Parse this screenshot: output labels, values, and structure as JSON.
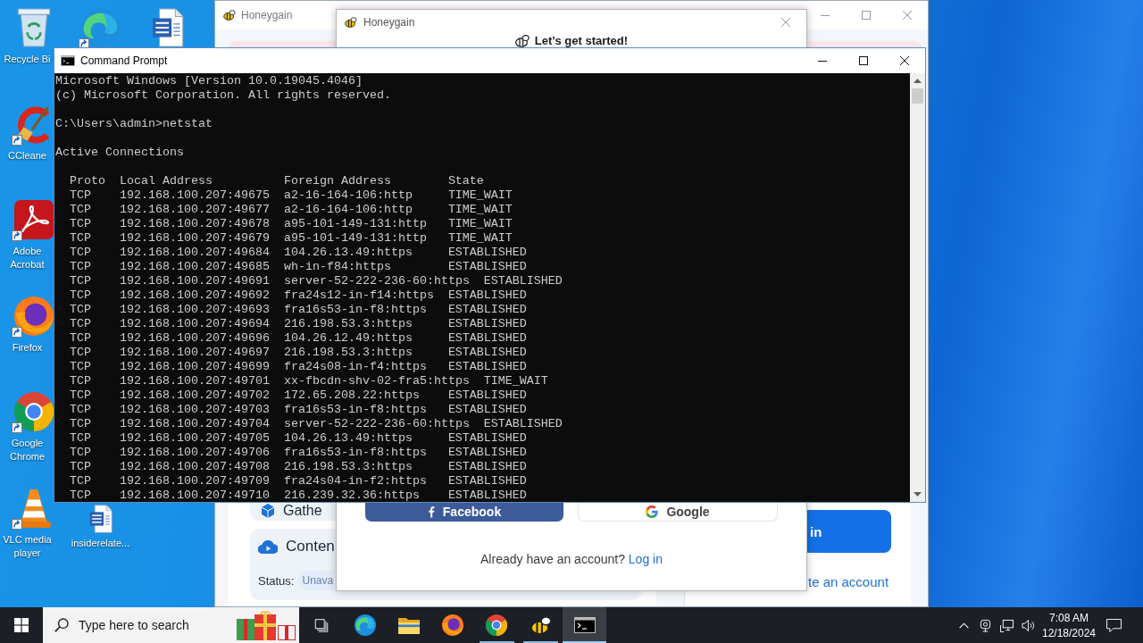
{
  "desktop": {
    "icons": [
      {
        "kind": "recycle-bin",
        "label": "Recycle Bi",
        "shortcut": false
      },
      {
        "kind": "edge",
        "shortcut": true
      },
      {
        "kind": "word",
        "shortcut": false
      },
      {
        "kind": "ccleaner",
        "label": "CCleane",
        "shortcut": true
      },
      {
        "kind": "acrobat",
        "label": "Adobe Acrobat",
        "shortcut": true
      },
      {
        "kind": "firefox",
        "label": "Firefox",
        "shortcut": true
      },
      {
        "kind": "chrome",
        "label": "Google Chrome",
        "shortcut": true
      },
      {
        "kind": "vlc",
        "label": "VLC media player",
        "shortcut": true
      },
      {
        "kind": "word",
        "label": "insiderelate...",
        "shortcut": false
      }
    ]
  },
  "honeygain_window": {
    "title": "Honeygain",
    "cards": [
      {
        "kind": "gathering",
        "title": "Gathe"
      },
      {
        "kind": "content-delivery",
        "title": "Conten",
        "status_label": "Status:",
        "status": "Unava"
      }
    ],
    "side_panel": {
      "button": "in",
      "link": "te an account"
    }
  },
  "signup_dialog": {
    "title": "Honeygain",
    "heading": "Let’s get started!",
    "social_buttons": [
      {
        "kind": "facebook",
        "label": "Facebook"
      },
      {
        "kind": "google",
        "label": "Google"
      }
    ],
    "login_prompt": "Already have an account?",
    "login_link": "Log in"
  },
  "command_prompt": {
    "title": "Command Prompt",
    "banner": [
      "Microsoft Windows [Version 10.0.19045.4046]",
      "(c) Microsoft Corporation. All rights reserved."
    ],
    "prompt": "C:\\Users\\admin>netstat",
    "section": "Active Connections",
    "columns": [
      "Proto",
      "Local Address",
      "Foreign Address",
      "State"
    ],
    "rows": [
      {
        "proto": "TCP",
        "local_address": "192.168.100.207:49675",
        "foreign_address": "a2-16-164-106:http",
        "state": "TIME_WAIT"
      },
      {
        "proto": "TCP",
        "local_address": "192.168.100.207:49677",
        "foreign_address": "a2-16-164-106:http",
        "state": "TIME_WAIT"
      },
      {
        "proto": "TCP",
        "local_address": "192.168.100.207:49678",
        "foreign_address": "a95-101-149-131:http",
        "state": "TIME_WAIT"
      },
      {
        "proto": "TCP",
        "local_address": "192.168.100.207:49679",
        "foreign_address": "a95-101-149-131:http",
        "state": "TIME_WAIT"
      },
      {
        "proto": "TCP",
        "local_address": "192.168.100.207:49684",
        "foreign_address": "104.26.13.49:https",
        "state": "ESTABLISHED"
      },
      {
        "proto": "TCP",
        "local_address": "192.168.100.207:49685",
        "foreign_address": "wh-in-f84:https",
        "state": "ESTABLISHED"
      },
      {
        "proto": "TCP",
        "local_address": "192.168.100.207:49691",
        "foreign_address": "server-52-222-236-60:https",
        "state": "ESTABLISHED"
      },
      {
        "proto": "TCP",
        "local_address": "192.168.100.207:49692",
        "foreign_address": "fra24s12-in-f14:https",
        "state": "ESTABLISHED"
      },
      {
        "proto": "TCP",
        "local_address": "192.168.100.207:49693",
        "foreign_address": "fra16s53-in-f8:https",
        "state": "ESTABLISHED"
      },
      {
        "proto": "TCP",
        "local_address": "192.168.100.207:49694",
        "foreign_address": "216.198.53.3:https",
        "state": "ESTABLISHED"
      },
      {
        "proto": "TCP",
        "local_address": "192.168.100.207:49696",
        "foreign_address": "104.26.12.49:https",
        "state": "ESTABLISHED"
      },
      {
        "proto": "TCP",
        "local_address": "192.168.100.207:49697",
        "foreign_address": "216.198.53.3:https",
        "state": "ESTABLISHED"
      },
      {
        "proto": "TCP",
        "local_address": "192.168.100.207:49699",
        "foreign_address": "fra24s08-in-f4:https",
        "state": "ESTABLISHED"
      },
      {
        "proto": "TCP",
        "local_address": "192.168.100.207:49701",
        "foreign_address": "xx-fbcdn-shv-02-fra5:https",
        "state": "TIME_WAIT"
      },
      {
        "proto": "TCP",
        "local_address": "192.168.100.207:49702",
        "foreign_address": "172.65.208.22:https",
        "state": "ESTABLISHED"
      },
      {
        "proto": "TCP",
        "local_address": "192.168.100.207:49703",
        "foreign_address": "fra16s53-in-f8:https",
        "state": "ESTABLISHED"
      },
      {
        "proto": "TCP",
        "local_address": "192.168.100.207:49704",
        "foreign_address": "server-52-222-236-60:https",
        "state": "ESTABLISHED"
      },
      {
        "proto": "TCP",
        "local_address": "192.168.100.207:49705",
        "foreign_address": "104.26.13.49:https",
        "state": "ESTABLISHED"
      },
      {
        "proto": "TCP",
        "local_address": "192.168.100.207:49706",
        "foreign_address": "fra16s53-in-f8:https",
        "state": "ESTABLISHED"
      },
      {
        "proto": "TCP",
        "local_address": "192.168.100.207:49708",
        "foreign_address": "216.198.53.3:https",
        "state": "ESTABLISHED"
      },
      {
        "proto": "TCP",
        "local_address": "192.168.100.207:49709",
        "foreign_address": "fra24s04-in-f2:https",
        "state": "ESTABLISHED"
      },
      {
        "proto": "TCP",
        "local_address": "192.168.100.207:49710",
        "foreign_address": "216.239.32.36:https",
        "state": "ESTABLISHED"
      }
    ]
  },
  "taskbar": {
    "search": {
      "placeholder": "Type here to search"
    },
    "apps": [
      {
        "kind": "edge",
        "running": false,
        "active": false
      },
      {
        "kind": "file-explorer",
        "running": false,
        "active": false
      },
      {
        "kind": "firefox",
        "running": false,
        "active": false
      },
      {
        "kind": "chrome",
        "running": true,
        "active": false
      },
      {
        "kind": "honeygain",
        "running": true,
        "active": false
      },
      {
        "kind": "cmd",
        "running": true,
        "active": true
      }
    ],
    "clock": {
      "time": "7:08 AM",
      "date": "12/18/2024"
    }
  }
}
